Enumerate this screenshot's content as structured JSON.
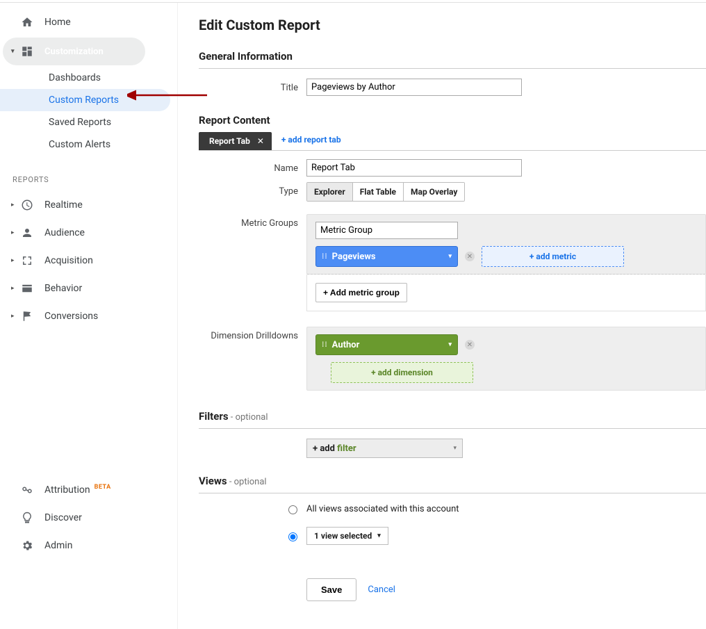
{
  "sidebar": {
    "home": "Home",
    "customization": "Customization",
    "custom_sub": {
      "dashboards": "Dashboards",
      "custom_reports": "Custom Reports",
      "saved_reports": "Saved Reports",
      "custom_alerts": "Custom Alerts"
    },
    "reports_label": "REPORTS",
    "realtime": "Realtime",
    "audience": "Audience",
    "acquisition": "Acquisition",
    "behavior": "Behavior",
    "conversions": "Conversions",
    "attribution": "Attribution",
    "attribution_beta": "BETA",
    "discover": "Discover",
    "admin": "Admin"
  },
  "page": {
    "title": "Edit Custom Report"
  },
  "general": {
    "heading": "General Information",
    "title_label": "Title",
    "title_value": "Pageviews by Author"
  },
  "content": {
    "heading": "Report Content",
    "tab_name": "Report Tab",
    "add_tab": "+ add report tab",
    "name_label": "Name",
    "name_value": "Report Tab",
    "type_label": "Type",
    "types": {
      "explorer": "Explorer",
      "flat": "Flat Table",
      "map": "Map Overlay"
    },
    "metric_groups_label": "Metric Groups",
    "metric_group_name": "Metric Group",
    "metric_pill": "Pageviews",
    "add_metric": "+ add metric",
    "add_metric_group": "+ Add metric group",
    "dim_label": "Dimension Drilldowns",
    "dim_pill": "Author",
    "add_dimension": "+ add dimension"
  },
  "filters": {
    "heading": "Filters",
    "optional": " - optional",
    "add": "+ add ",
    "filter_word": "filter"
  },
  "views": {
    "heading": "Views",
    "optional": " - optional",
    "all": "All views associated with this account",
    "selected": "1 view selected"
  },
  "actions": {
    "save": "Save",
    "cancel": "Cancel"
  }
}
